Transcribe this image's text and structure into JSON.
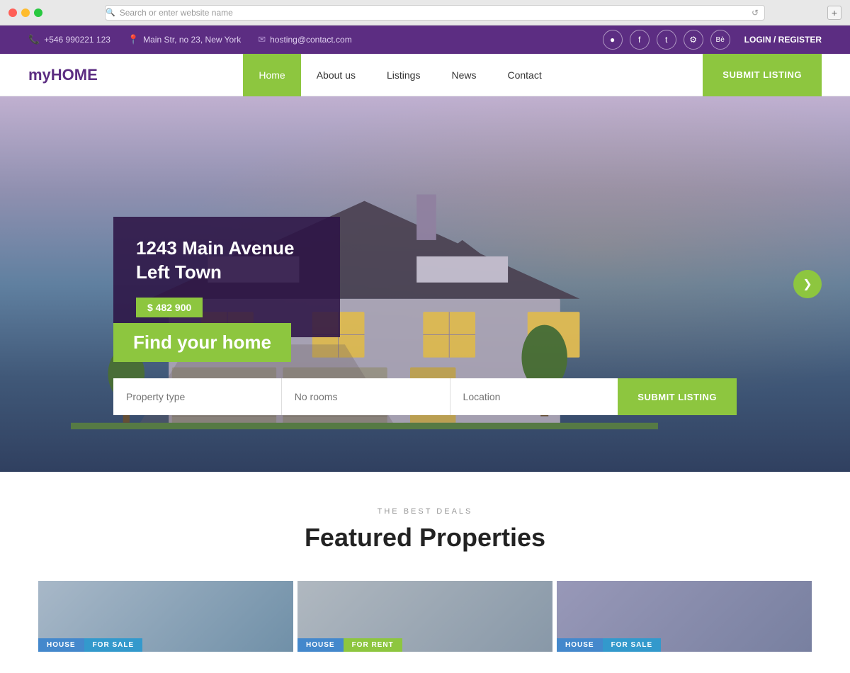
{
  "browser": {
    "address_placeholder": "Search or enter website name"
  },
  "topbar": {
    "phone": "+546 990221 123",
    "address": "Main Str, no 23, New York",
    "email": "hosting@contact.com",
    "login": "LOGIN / REGISTER",
    "social": [
      "●",
      "f",
      "t",
      "⚙",
      "Be"
    ]
  },
  "nav": {
    "logo_my": "my",
    "logo_home": "HOME",
    "links": [
      "Home",
      "About us",
      "Listings",
      "News",
      "Contact"
    ],
    "active_link": "Home",
    "submit_btn": "SUBMIT LISTING"
  },
  "hero": {
    "property_title": "1243 Main Avenue Left Town",
    "property_price": "$ 482 900",
    "find_home": "Find your home",
    "search": {
      "property_type": "Property type",
      "no_rooms": "No rooms",
      "location": "Location",
      "submit": "SUBMIT LISTING"
    },
    "slider_arrow": "❯"
  },
  "featured": {
    "subtitle": "THE BEST DEALS",
    "title": "Featured Properties",
    "properties": [
      {
        "type": "HOUSE",
        "status": "FOR SALE",
        "type_color": "#4488cc",
        "status_color": "#3399cc"
      },
      {
        "type": "HOUSE",
        "status": "FOR RENT",
        "type_color": "#4488cc",
        "status_color": "#8dc63f"
      },
      {
        "type": "HOUSE",
        "status": "FOR SALE",
        "type_color": "#4488cc",
        "status_color": "#3399cc"
      }
    ]
  },
  "colors": {
    "purple": "#5c2d82",
    "green": "#8dc63f",
    "dark_overlay": "rgba(45, 20, 70, 0.88)"
  }
}
